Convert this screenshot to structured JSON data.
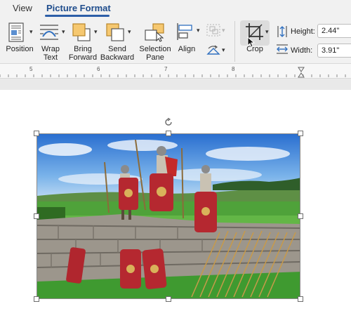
{
  "tabs": {
    "view": "View",
    "picture_format": "Picture Format"
  },
  "ribbon": {
    "position": "Position",
    "wrap_text": [
      "Wrap",
      "Text"
    ],
    "bring_forward": [
      "Bring",
      "Forward"
    ],
    "send_backward": [
      "Send",
      "Backward"
    ],
    "selection_pane": [
      "Selection",
      "Pane"
    ],
    "align": "Align",
    "crop": "Crop",
    "height_label": "Height:",
    "height_value": "2.44\"",
    "width_label": "Width:",
    "width_value": "3.91\""
  },
  "ruler": {
    "numbers": [
      "5",
      "6",
      "7",
      "8"
    ]
  },
  "colors": {
    "accent": "#2c5ea8",
    "tab_active_text": "#1e4c8c"
  },
  "icons": [
    "position-icon",
    "wrap-text-icon",
    "bring-forward-icon",
    "send-backward-icon",
    "selection-pane-icon",
    "align-icon",
    "group-icon",
    "rotate-icon",
    "crop-icon",
    "height-icon",
    "width-icon",
    "rotate-handle-icon",
    "mouse-pointer-icon"
  ]
}
